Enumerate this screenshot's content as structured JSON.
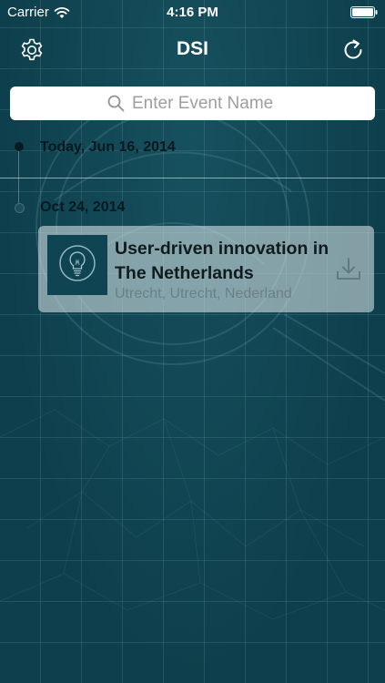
{
  "status_bar": {
    "carrier": "Carrier",
    "time": "4:16 PM"
  },
  "nav": {
    "title": "DSI",
    "left_icon": "gear-icon",
    "right_icon": "refresh-icon"
  },
  "search": {
    "placeholder": "Enter Event Name",
    "value": ""
  },
  "timeline": {
    "today_label": "Today, Jun 16, 2014",
    "groups": [
      {
        "date": "Oct 24, 2014",
        "events": [
          {
            "title": "User-driven innovation in The Netherlands",
            "location": "Utrecht, Utrecht, Nederland",
            "thumbnail_icon": "lightbulb-icon",
            "action_icon": "download-icon"
          }
        ]
      }
    ]
  },
  "colors": {
    "background": "#0e3f4c",
    "card": "#d7e4e6",
    "thumbnail": "#0f4452",
    "accent_text": "#061920"
  }
}
